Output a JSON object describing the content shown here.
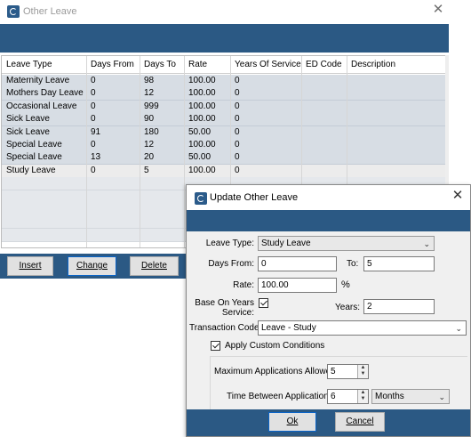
{
  "main_window": {
    "title": "Other Leave",
    "close_glyph": "✕",
    "columns": [
      "Leave Type",
      "Days From",
      "Days To",
      "Rate",
      "Years Of Service",
      "ED Code",
      "Description"
    ],
    "rows": [
      [
        "Maternity Leave",
        "0",
        "98",
        "100.00",
        "0",
        "",
        ""
      ],
      [
        "Mothers Day Leave",
        "0",
        "12",
        "100.00",
        "0",
        "",
        ""
      ],
      [
        "Occasional Leave",
        "0",
        "999",
        "100.00",
        "0",
        "",
        ""
      ],
      [
        "Sick Leave",
        "0",
        "90",
        "100.00",
        "0",
        "",
        ""
      ],
      [
        "Sick Leave",
        "91",
        "180",
        "50.00",
        "0",
        "",
        ""
      ],
      [
        "Special Leave",
        "0",
        "12",
        "100.00",
        "0",
        "",
        ""
      ],
      [
        "Special Leave",
        "13",
        "20",
        "50.00",
        "0",
        "",
        ""
      ],
      [
        "Study Leave",
        "0",
        "5",
        "100.00",
        "0",
        "",
        ""
      ]
    ],
    "buttons": {
      "insert": "Insert",
      "change": "Change",
      "delete": "Delete"
    }
  },
  "dialog": {
    "title": "Update Other Leave",
    "close_glyph": "✕",
    "leave_type_label": "Leave Type:",
    "leave_type_value": "Study Leave",
    "days_from_label": "Days From:",
    "days_from_value": "0",
    "to_label": "To:",
    "to_value": "5",
    "rate_label": "Rate:",
    "rate_value": "100.00",
    "percent": "%",
    "base_on_years_label": "Base On Years Service:",
    "base_on_years_checked": true,
    "years_label": "Years:",
    "years_value": "2",
    "transaction_code_label": "Transaction Code:",
    "transaction_code_value": "Leave - Study",
    "apply_custom_label": "Apply Custom Conditions",
    "apply_custom_checked": true,
    "max_apps_label": "Maximum Applications Allowed",
    "max_apps_value": "5",
    "time_between_label": "Time Between Applications",
    "time_between_value": "6",
    "time_unit_value": "Months",
    "ok_label": "Ok",
    "cancel_label": "Cancel"
  }
}
